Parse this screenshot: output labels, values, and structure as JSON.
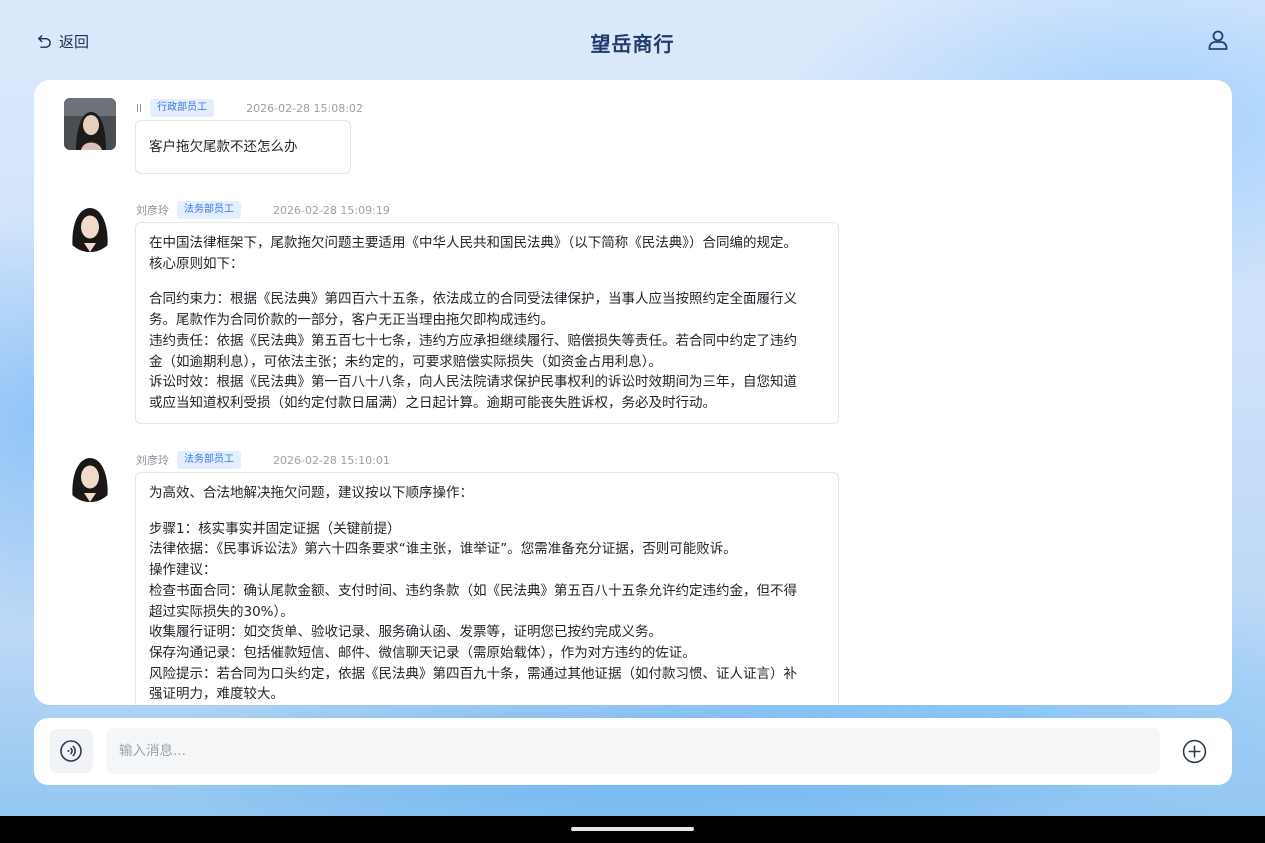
{
  "header": {
    "back_label": "返回",
    "title": "望岳商行"
  },
  "messages": [
    {
      "sender": "ll",
      "badge": "行政部员工",
      "time": "2026-02-28 15:08:02",
      "lines": [
        "客户拖欠尾款不还怎么办"
      ]
    },
    {
      "sender": "刘彦玲",
      "badge": "法务部员工",
      "time": "2026-02-28 15:09:19",
      "para1": [
        "在中国法律框架下，尾款拖欠问题主要适用《中华人民共和国民法典》（以下简称《民法典》）合同编的规定。",
        "核心原则如下："
      ],
      "para2": [
        "合同约束力：根据《民法典》第四百六十五条，依法成立的合同受法律保护，当事人应当按照约定全面履行义",
        "务。尾款作为合同价款的一部分，客户无正当理由拖欠即构成违约。",
        "违约责任：依据《民法典》第五百七十七条，违约方应承担继续履行、赔偿损失等责任。若合同中约定了违约",
        "金（如逾期利息），可依法主张；未约定的，可要求赔偿实际损失（如资金占用利息）。",
        "诉讼时效：根据《民法典》第一百八十八条，向人民法院请求保护民事权利的诉讼时效期间为三年，自您知道",
        "或应当知道权利受损（如约定付款日届满）之日起计算。逾期可能丧失胜诉权，务必及时行动。"
      ]
    },
    {
      "sender": "刘彦玲",
      "badge": "法务部员工",
      "time": "2026-02-28 15:10:01",
      "para1": [
        "为高效、合法地解决拖欠问题，建议按以下顺序操作："
      ],
      "para2": [
        "步骤1：核实事实并固定证据（关键前提）",
        "法律依据：《民事诉讼法》第六十四条要求“谁主张，谁举证”。您需准备充分证据，否则可能败诉。",
        "操作建议：",
        "检查书面合同：确认尾款金额、支付时间、违约条款（如《民法典》第五百八十五条允许约定违约金，但不得",
        "超过实际损失的30%）。",
        "收集履行证明：如交货单、验收记录、服务确认函、发票等，证明您已按约完成义务。",
        "保存沟通记录：包括催款短信、邮件、微信聊天记录（需原始载体），作为对方违约的佐证。",
        "风险提示：若合同为口头约定，依据《民法典》第四百九十条，需通过其他证据（如付款习惯、证人证言）补",
        "强证明力，难度较大。"
      ]
    }
  ],
  "input": {
    "placeholder": "输入消息..."
  },
  "icons": {
    "back": "undo-arrow-icon",
    "user": "user-profile-icon",
    "voice": "voice-input-icon",
    "plus": "plus-circle-icon"
  },
  "colors": {
    "title": "#213a6e",
    "badge_bg": "#e3efff",
    "badge_text": "#3a78e6"
  }
}
